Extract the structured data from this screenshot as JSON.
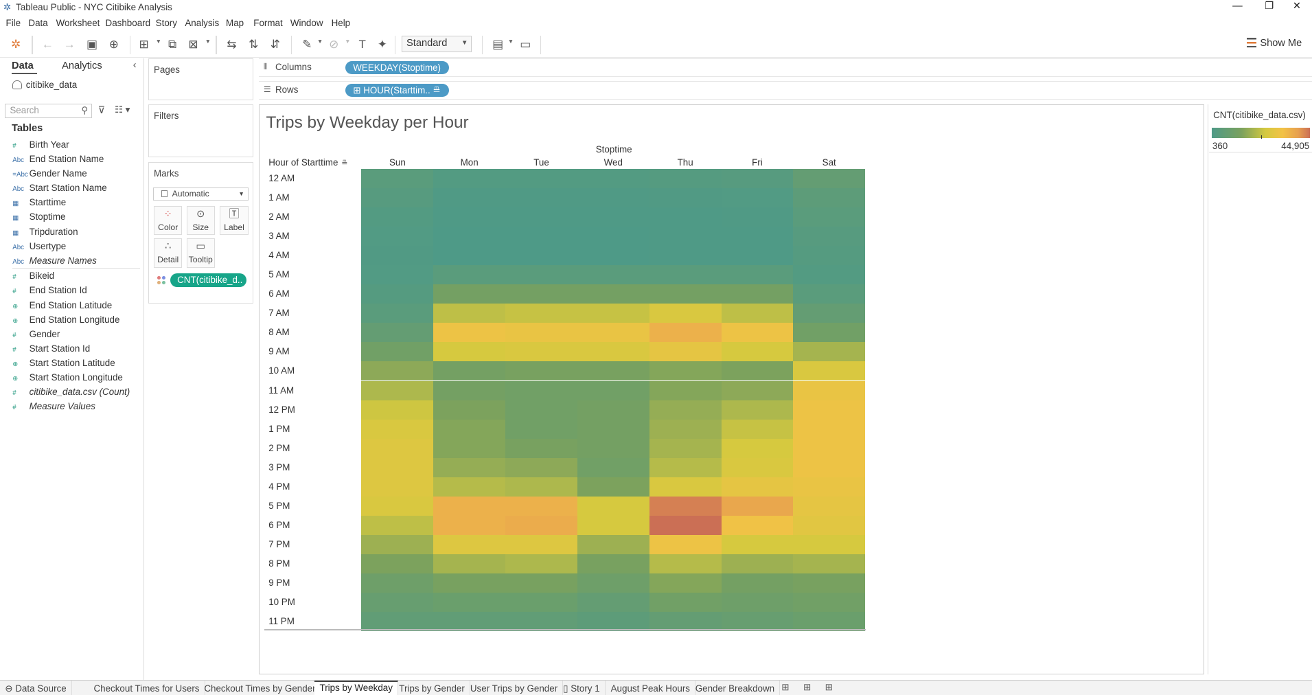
{
  "window": {
    "title": "Tableau Public - NYC Citibike Analysis"
  },
  "menu": [
    "File",
    "Data",
    "Worksheet",
    "Dashboard",
    "Story",
    "Analysis",
    "Map",
    "Format",
    "Window",
    "Help"
  ],
  "toolbar": {
    "fit_select": "Standard",
    "show_me": "Show Me"
  },
  "data_pane": {
    "tabs": [
      "Data",
      "Analytics"
    ],
    "datasource": "citibike_data",
    "search_placeholder": "Search",
    "tables_heading": "Tables",
    "dimensions": [
      {
        "name": "Birth Year",
        "type": "number",
        "italic": false
      },
      {
        "name": "End Station Name",
        "type": "string",
        "italic": false
      },
      {
        "name": "Gender Name",
        "type": "string-calc",
        "italic": false
      },
      {
        "name": "Start Station Name",
        "type": "string",
        "italic": false
      },
      {
        "name": "Starttime",
        "type": "date",
        "italic": false
      },
      {
        "name": "Stoptime",
        "type": "date",
        "italic": false
      },
      {
        "name": "Tripduration",
        "type": "date",
        "italic": false
      },
      {
        "name": "Usertype",
        "type": "string",
        "italic": false
      },
      {
        "name": "Measure Names",
        "type": "string",
        "italic": true
      }
    ],
    "measures": [
      {
        "name": "Bikeid",
        "type": "number",
        "italic": false
      },
      {
        "name": "End Station Id",
        "type": "number",
        "italic": false
      },
      {
        "name": "End Station Latitude",
        "type": "geo",
        "italic": false
      },
      {
        "name": "End Station Longitude",
        "type": "geo",
        "italic": false
      },
      {
        "name": "Gender",
        "type": "number",
        "italic": false
      },
      {
        "name": "Start Station Id",
        "type": "number",
        "italic": false
      },
      {
        "name": "Start Station Latitude",
        "type": "geo",
        "italic": false
      },
      {
        "name": "Start Station Longitude",
        "type": "geo",
        "italic": false
      },
      {
        "name": "citibike_data.csv (Count)",
        "type": "number",
        "italic": true
      },
      {
        "name": "Measure Values",
        "type": "number",
        "italic": true
      }
    ]
  },
  "cards": {
    "pages": "Pages",
    "filters": "Filters",
    "marks": "Marks",
    "mark_type": "Automatic",
    "mark_buttons": [
      "Color",
      "Size",
      "Label",
      "Detail",
      "Tooltip"
    ],
    "color_pill": "CNT(citibike_d.."
  },
  "shelves": {
    "columns_label": "Columns",
    "columns_pill": "WEEKDAY(Stoptime)",
    "rows_label": "Rows",
    "rows_pill": "HOUR(Starttim.."
  },
  "viz": {
    "title": "Trips by Weekday per Hour",
    "column_header_title": "Stoptime",
    "row_header_title": "Hour of Starttime"
  },
  "legend": {
    "title": "CNT(citibike_data.csv)",
    "min_label": "360",
    "max_label": "44,905",
    "colors": [
      "#4e9a87",
      "#7aa15e",
      "#d5c93f",
      "#f2c246",
      "#e7a04f",
      "#cb6f55"
    ]
  },
  "chart_data": {
    "type": "heatmap",
    "title": "Trips by Weekday per Hour",
    "x_title": "Stoptime",
    "y_title": "Hour of Starttime",
    "x": [
      "Sun",
      "Mon",
      "Tue",
      "Wed",
      "Thu",
      "Fri",
      "Sat"
    ],
    "y": [
      "12 AM",
      "1 AM",
      "2 AM",
      "3 AM",
      "4 AM",
      "5 AM",
      "6 AM",
      "7 AM",
      "8 AM",
      "9 AM",
      "10 AM",
      "11 AM",
      "12 PM",
      "1 PM",
      "2 PM",
      "3 PM",
      "4 PM",
      "5 PM",
      "6 PM",
      "7 PM",
      "8 PM",
      "9 PM",
      "10 PM",
      "11 PM"
    ],
    "value_range": [
      360,
      44905
    ],
    "values": [
      [
        4000,
        2000,
        2000,
        2000,
        2500,
        3000,
        7000
      ],
      [
        3000,
        1000,
        1000,
        1000,
        1200,
        1500,
        5000
      ],
      [
        2000,
        700,
        700,
        700,
        800,
        1000,
        4000
      ],
      [
        1500,
        500,
        500,
        500,
        600,
        700,
        3000
      ],
      [
        1200,
        500,
        500,
        500,
        600,
        700,
        2500
      ],
      [
        1500,
        4000,
        4000,
        4000,
        4000,
        4000,
        2000
      ],
      [
        2500,
        12000,
        12000,
        12000,
        12000,
        12000,
        4000
      ],
      [
        4000,
        22000,
        23000,
        23000,
        26000,
        22000,
        7000
      ],
      [
        7000,
        31000,
        30000,
        30000,
        36000,
        31000,
        11000
      ],
      [
        11000,
        25000,
        26000,
        26000,
        29000,
        25000,
        19000
      ],
      [
        16000,
        12000,
        13000,
        13000,
        15000,
        14000,
        26000
      ],
      [
        20000,
        12000,
        11000,
        11000,
        15000,
        16000,
        30000
      ],
      [
        24000,
        14000,
        11000,
        12000,
        17000,
        20000,
        31000
      ],
      [
        26000,
        15000,
        11000,
        12000,
        18000,
        23000,
        31000
      ],
      [
        27000,
        15000,
        13000,
        12000,
        19000,
        25000,
        31000
      ],
      [
        27000,
        17000,
        16000,
        11000,
        21000,
        26000,
        31000
      ],
      [
        27000,
        21000,
        20000,
        14000,
        26000,
        29000,
        30000
      ],
      [
        26000,
        36000,
        36000,
        25000,
        43000,
        38000,
        29000
      ],
      [
        22000,
        36000,
        37000,
        25000,
        44905,
        32000,
        28000
      ],
      [
        18000,
        27000,
        27000,
        18000,
        31000,
        25000,
        25000
      ],
      [
        14000,
        19000,
        20000,
        13000,
        21000,
        18000,
        19000
      ],
      [
        10000,
        13000,
        13000,
        10000,
        15000,
        12000,
        13000
      ],
      [
        8000,
        9000,
        9000,
        7000,
        11000,
        10000,
        11000
      ],
      [
        6000,
        6000,
        6000,
        5000,
        7000,
        8000,
        9000
      ]
    ]
  },
  "sheet_tabs": [
    "Data Source",
    "Checkout Times for Users",
    "Checkout Times by Gender",
    "Trips by Weekday",
    "Trips by Gender",
    "User Trips by Gender",
    "Story 1",
    "August Peak Hours",
    "Gender Breakdown"
  ],
  "active_tab": "Trips by Weekday"
}
